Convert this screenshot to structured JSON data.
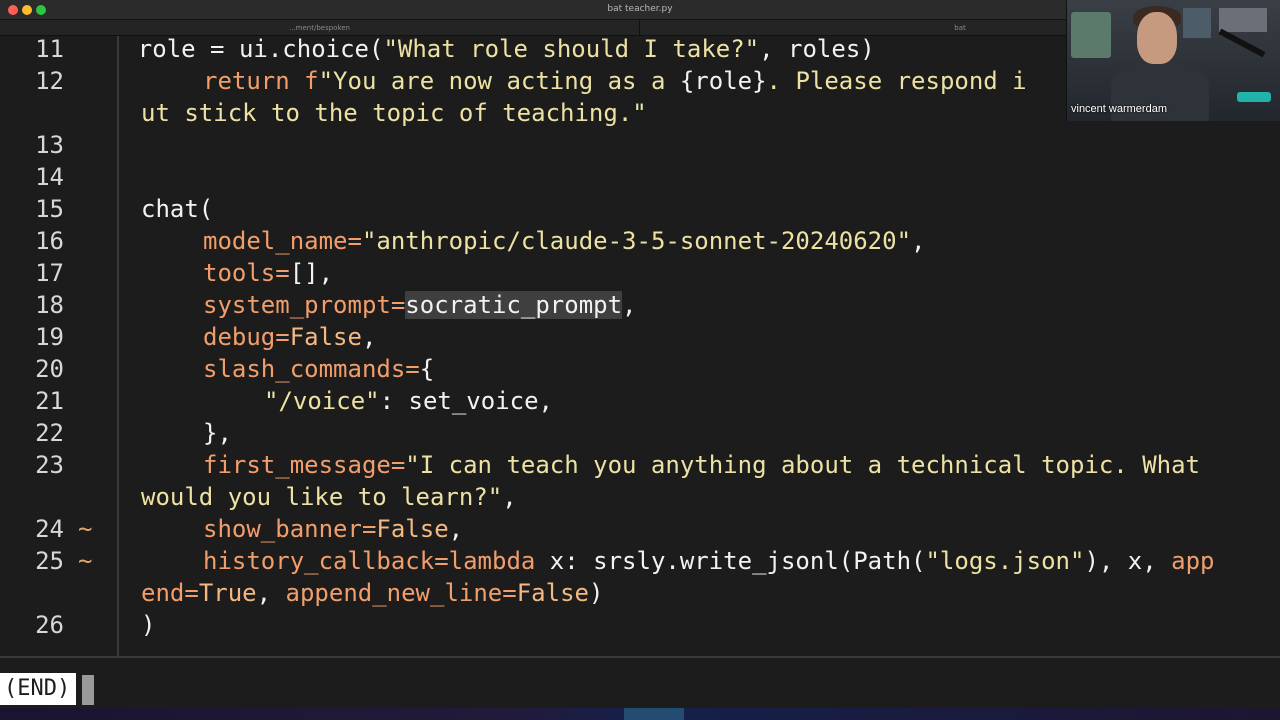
{
  "window": {
    "title": "bat teacher.py",
    "tabs": [
      {
        "label": "...ment/bespoken"
      },
      {
        "label": "bat"
      }
    ]
  },
  "editor": {
    "lines": [
      {
        "num": "11",
        "marker": ""
      },
      {
        "num": "12",
        "marker": ""
      },
      {
        "num": "13",
        "marker": ""
      },
      {
        "num": "14",
        "marker": ""
      },
      {
        "num": "15",
        "marker": ""
      },
      {
        "num": "16",
        "marker": ""
      },
      {
        "num": "17",
        "marker": ""
      },
      {
        "num": "18",
        "marker": ""
      },
      {
        "num": "19",
        "marker": ""
      },
      {
        "num": "20",
        "marker": ""
      },
      {
        "num": "21",
        "marker": ""
      },
      {
        "num": "22",
        "marker": ""
      },
      {
        "num": "23",
        "marker": ""
      },
      {
        "num": "24",
        "marker": "~"
      },
      {
        "num": "25",
        "marker": "~"
      },
      {
        "num": "26",
        "marker": ""
      }
    ],
    "code": {
      "l11_a": "    role = ui.choice(",
      "l11_s": "\"What role should I take?\"",
      "l11_b": ", roles)",
      "l12_kw": "return ",
      "l12_f": "f",
      "l12_s": "\"You are now acting as a ",
      "l12_role": "{role}",
      "l12_s2": ". Please respond i",
      "l12w_s": "ut stick to the topic of teaching.\"",
      "l15": "chat(",
      "l16_k": "model_name",
      "l16_s": "\"anthropic/claude-3-5-sonnet-20240620\"",
      "l17_k": "tools",
      "l17_v": "[],",
      "l18_k": "system_prompt",
      "l18_sel": "socratic_prompt",
      "l19_k": "debug",
      "l19_c": "False",
      "l20_k": "slash_commands",
      "l20_v": "{",
      "l21_s": "\"/voice\"",
      "l21_v": ": set_voice,",
      "l22": "},",
      "l23_k": "first_message",
      "l23_s": "\"I can teach you anything about a technical topic. What",
      "l23w_s": "would you like to learn?\"",
      "l24_k": "show_banner",
      "l24_c": "False",
      "l25_k": "history_callback",
      "l25_kw": "lambda",
      "l25_v": " x: srsly.write_jsonl(Path(",
      "l25_s": "\"logs.json\"",
      "l25_v2": "), x, ",
      "l25_k2": "app",
      "l25w_k": "end",
      "l25w_c": "True",
      "l25w_v": ", ",
      "l25w_k2": "append_new_line",
      "l25w_c2": "False",
      "l25w_v2": ")",
      "l26": ")"
    }
  },
  "status": {
    "text": "(END)"
  },
  "webcam": {
    "caption": "vincent warmerdam"
  }
}
